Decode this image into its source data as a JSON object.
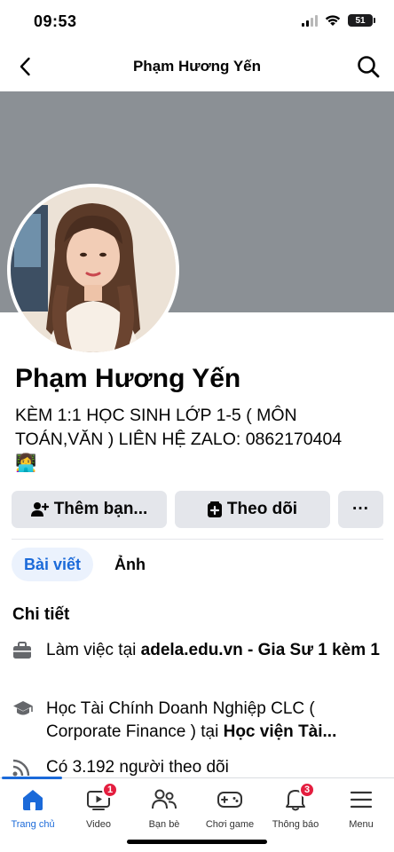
{
  "status_bar": {
    "time": "09:53",
    "battery": "51",
    "icons": [
      "signal-icon",
      "wifi-icon",
      "battery-icon"
    ]
  },
  "header": {
    "title": "Phạm Hương Yến",
    "back_icon": "chevron-left-icon",
    "search_icon": "search-icon"
  },
  "profile": {
    "name": "Phạm Hương Yến",
    "bio": "KÈM 1:1 HỌC SINH LỚP 1-5 ( MÔN TOÁN,VĂN ) LIÊN HỆ ZALO: 0862170404",
    "bio_emoji": "👩‍💻",
    "cover_color": "#8b9095"
  },
  "actions": {
    "add_friend": "Thêm bạn...",
    "follow": "Theo dõi",
    "more": "···"
  },
  "tabs": [
    {
      "label": "Bài viết",
      "active": true
    },
    {
      "label": "Ảnh",
      "active": false
    }
  ],
  "details": {
    "title": "Chi tiết",
    "work_prefix": "Làm việc tại ",
    "work_place": "adela.edu.vn - Gia Sư 1 kèm 1",
    "study_prefix": "Học Tài Chính Doanh Nghiệp CLC ( Corporate Finance ) tại ",
    "study_place": "Học viện Tài...",
    "followers": "Có 3.192 người theo dõi"
  },
  "bottom_nav": [
    {
      "label": "Trang chủ",
      "icon": "home-icon",
      "active": true,
      "badge": ""
    },
    {
      "label": "Video",
      "icon": "video-icon",
      "active": false,
      "badge": "1"
    },
    {
      "label": "Bạn bè",
      "icon": "friends-icon",
      "active": false,
      "badge": ""
    },
    {
      "label": "Chơi game",
      "icon": "gamepad-icon",
      "active": false,
      "badge": ""
    },
    {
      "label": "Thông báo",
      "icon": "bell-icon",
      "active": false,
      "badge": "3"
    },
    {
      "label": "Menu",
      "icon": "menu-icon",
      "active": false,
      "badge": ""
    }
  ],
  "colors": {
    "accent": "#1b6ad9",
    "badge": "#e41e3f",
    "button_bg": "#e4e6eb"
  }
}
